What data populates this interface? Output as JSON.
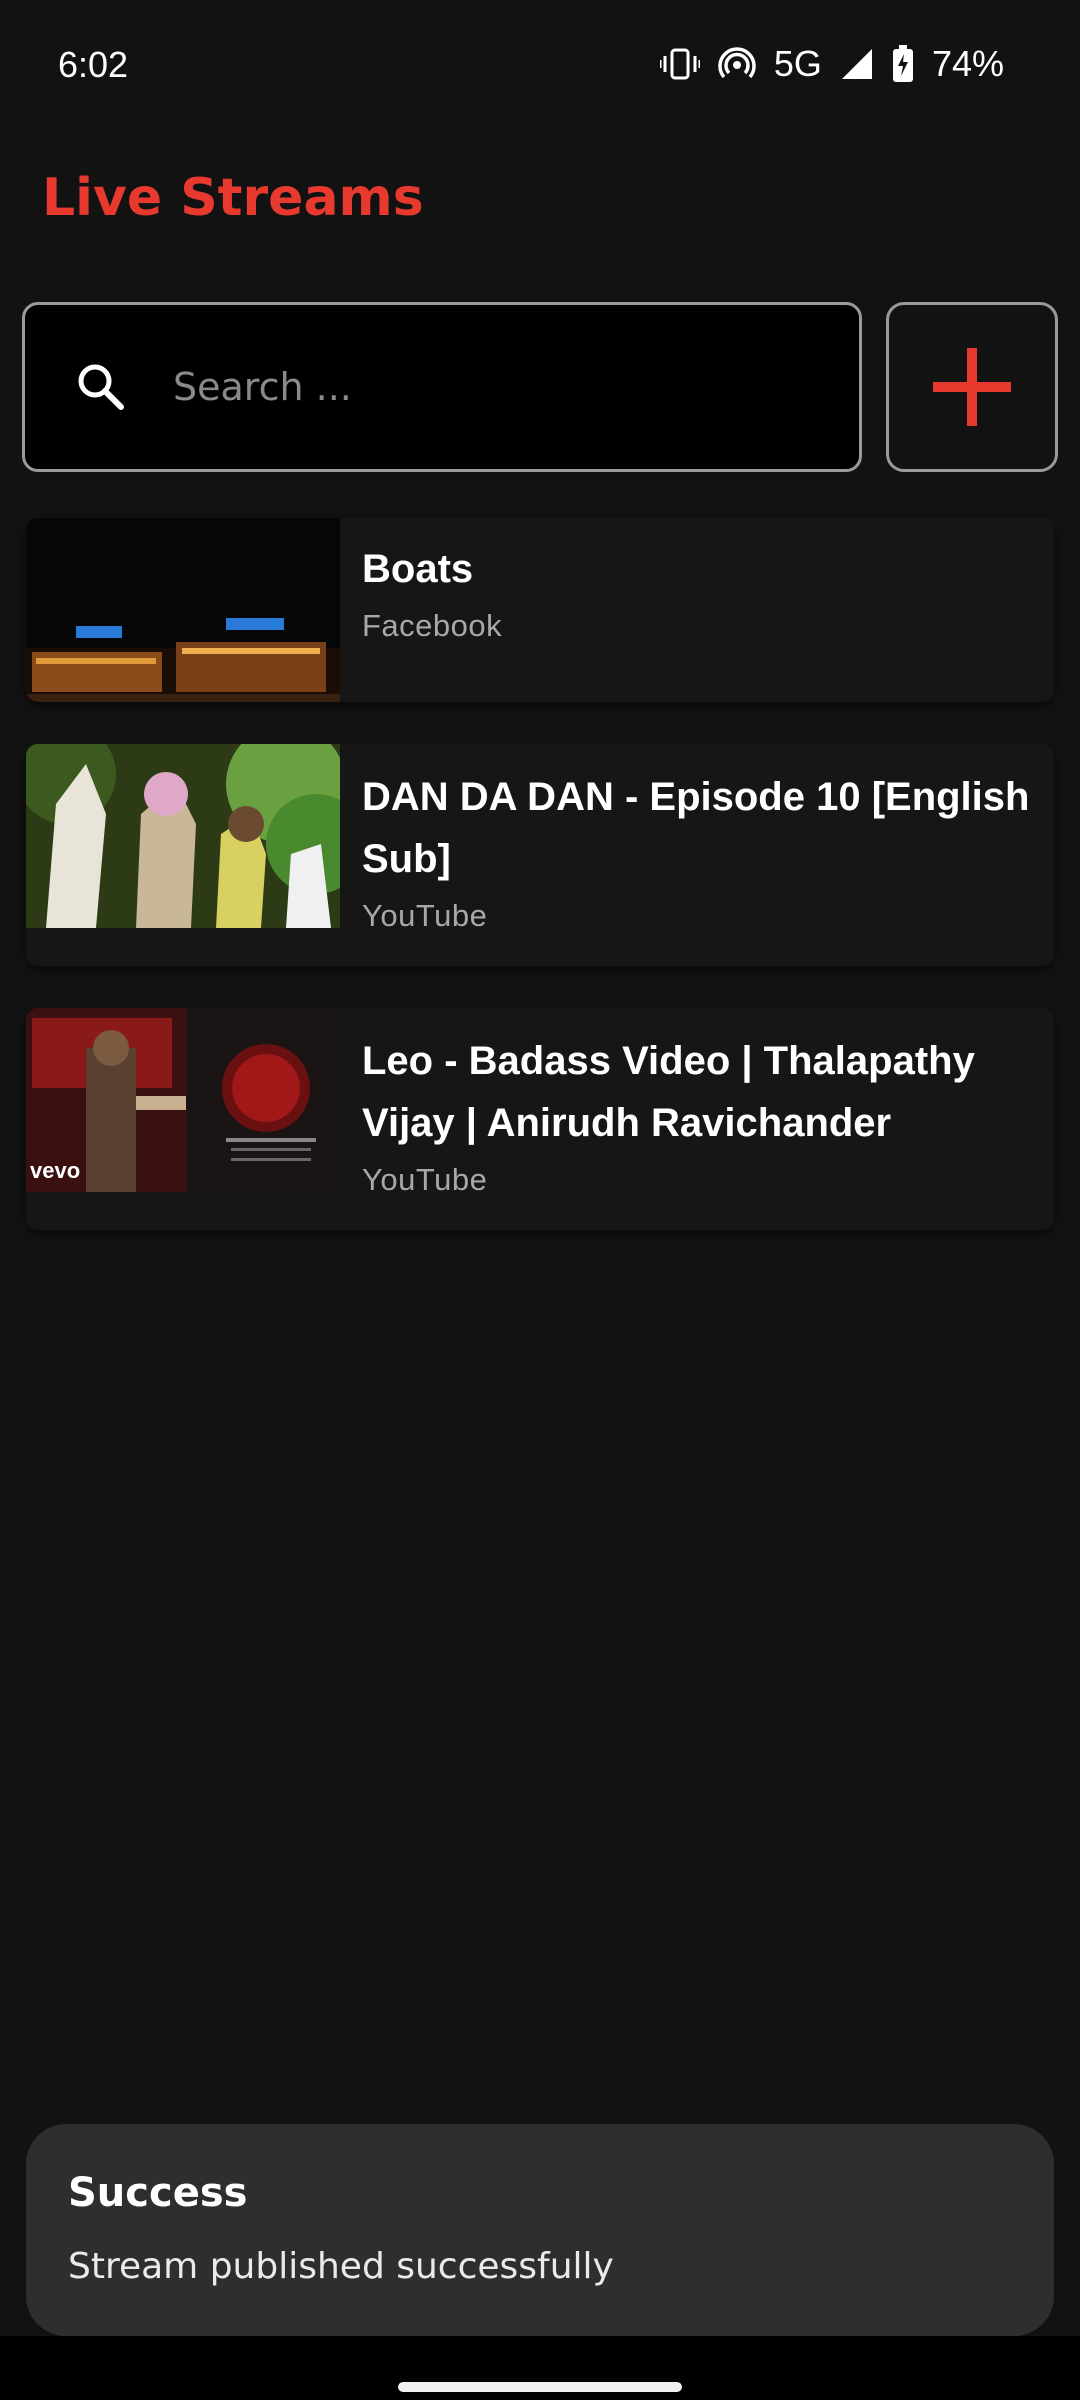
{
  "status_bar": {
    "time": "6:02",
    "network": "5G",
    "battery": "74%"
  },
  "header": {
    "title": "Live Streams",
    "title_color": "#e8392f"
  },
  "search": {
    "placeholder": "Search ...",
    "value": ""
  },
  "add_button": {
    "icon": "plus-icon"
  },
  "streams": [
    {
      "title": "Boats",
      "source": "Facebook"
    },
    {
      "title": "DAN DA DAN - Episode 10 [English Sub]",
      "source": "YouTube"
    },
    {
      "title": "Leo - Badass Video | Thalapathy Vijay | Anirudh Ravichander",
      "source": "YouTube"
    }
  ],
  "toast": {
    "title": "Success",
    "message": "Stream published successfully"
  }
}
